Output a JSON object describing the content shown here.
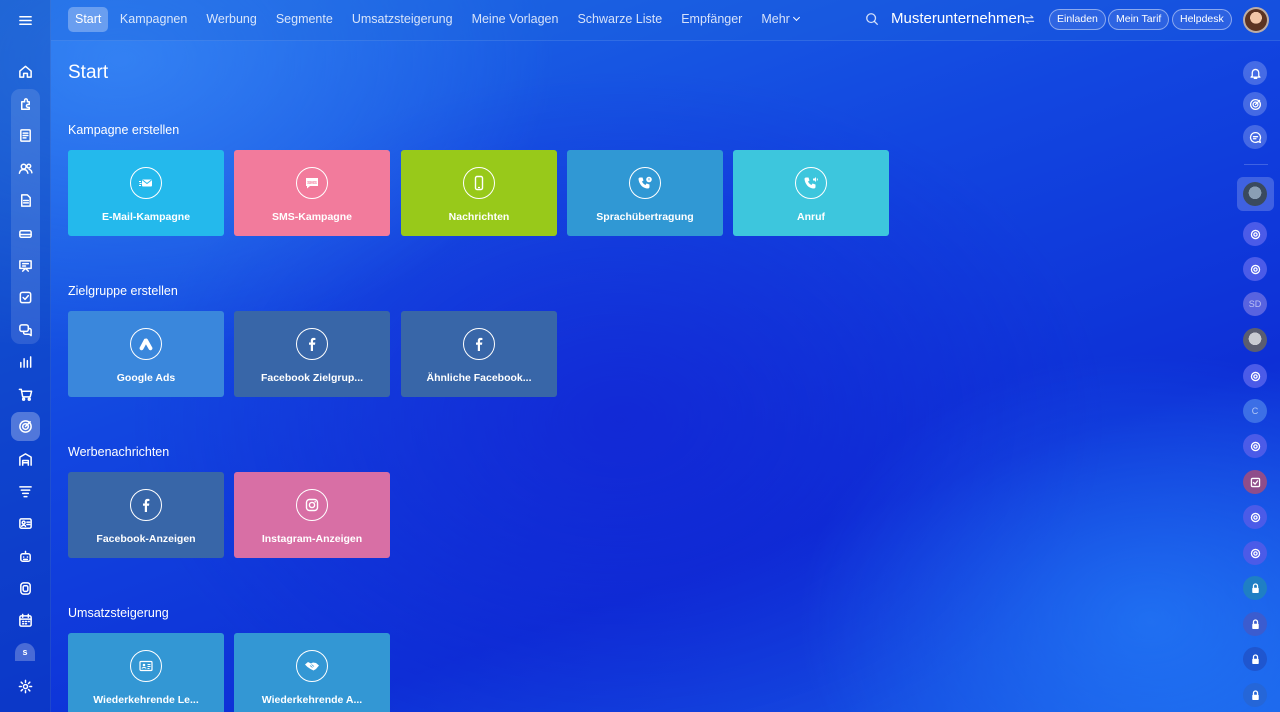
{
  "nav": {
    "items": [
      {
        "label": "Start"
      },
      {
        "label": "Kampagnen"
      },
      {
        "label": "Werbung"
      },
      {
        "label": "Segmente"
      },
      {
        "label": "Umsatzsteigerung"
      },
      {
        "label": "Meine Vorlagen"
      },
      {
        "label": "Schwarze Liste"
      },
      {
        "label": "Empfänger"
      },
      {
        "label": "Mehr"
      }
    ],
    "company": "Musterunternehmen",
    "invite_label": "Einladen",
    "tariff_label": "Mein Tarif",
    "helpdesk_label": "Helpdesk"
  },
  "page": {
    "title": "Start"
  },
  "sections": [
    {
      "title": "Kampagne erstellen",
      "tiles": [
        {
          "label": "E-Mail-Kampagne",
          "icon": "email-icon",
          "color": "#24b9ec"
        },
        {
          "label": "SMS-Kampagne",
          "icon": "sms-icon",
          "color": "#f27b9c"
        },
        {
          "label": "Nachrichten",
          "icon": "mobile-phone-icon",
          "color": "#98c91a"
        },
        {
          "label": "Sprachübertragung",
          "icon": "voice-call-icon",
          "color": "#3098d4"
        },
        {
          "label": "Anruf",
          "icon": "phone-call-icon",
          "color": "#3dc6dd"
        }
      ]
    },
    {
      "title": "Zielgruppe erstellen",
      "tiles": [
        {
          "label": "Google Ads",
          "icon": "google-ads-icon",
          "color": "#3a87dc"
        },
        {
          "label": "Facebook Zielgrup...",
          "icon": "facebook-icon",
          "color": "#3866a8"
        },
        {
          "label": "Ähnliche Facebook...",
          "icon": "facebook-icon",
          "color": "#3866a8"
        }
      ]
    },
    {
      "title": "Werbenachrichten",
      "tiles": [
        {
          "label": "Facebook-Anzeigen",
          "icon": "facebook-icon",
          "color": "#3866a8"
        },
        {
          "label": "Instagram-Anzeigen",
          "icon": "instagram-icon",
          "color": "#d86fa5"
        }
      ]
    },
    {
      "title": "Umsatzsteigerung",
      "tiles": [
        {
          "label": "Wiederkehrende Le...",
          "icon": "contact-card-icon",
          "color": "#3397d4"
        },
        {
          "label": "Wiederkehrende A...",
          "icon": "handshake-icon",
          "color": "#3397d4"
        }
      ]
    }
  ],
  "left_sidebar": {
    "icons": [
      "home-icon",
      "puzzle-icon",
      "tasks-icon",
      "contacts-icon",
      "document-icon",
      "inventory-icon",
      "presentation-icon",
      "checkbox-icon",
      "chat-icon",
      "analytics-icon",
      "shop-icon",
      "marketing-icon",
      "warehouse-icon",
      "filter-icon",
      "id-card-icon",
      "robot-icon",
      "portal-icon",
      "calendar-icon",
      "settings-icon"
    ],
    "user_badge": "s"
  },
  "right_sidebar": {
    "text_badges": [
      "SD",
      "C"
    ]
  }
}
